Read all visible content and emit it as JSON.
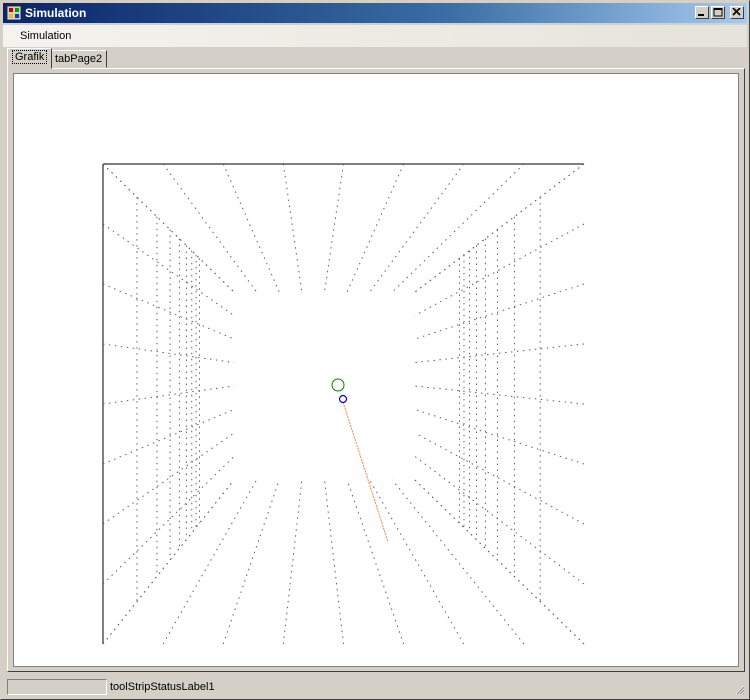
{
  "window": {
    "title": "Simulation"
  },
  "menu": {
    "items": [
      {
        "label": "Simulation"
      }
    ]
  },
  "tabs": [
    {
      "label": "Grafik",
      "active": true
    },
    {
      "label": "tabPage2",
      "active": false
    }
  ],
  "status": {
    "progress": 0,
    "label": "toolStripStatusLabel1"
  },
  "colors": {
    "ball_outer": "#008000",
    "ball_inner": "#0000c0",
    "trail": "#ff8040",
    "grid": "#606060"
  }
}
